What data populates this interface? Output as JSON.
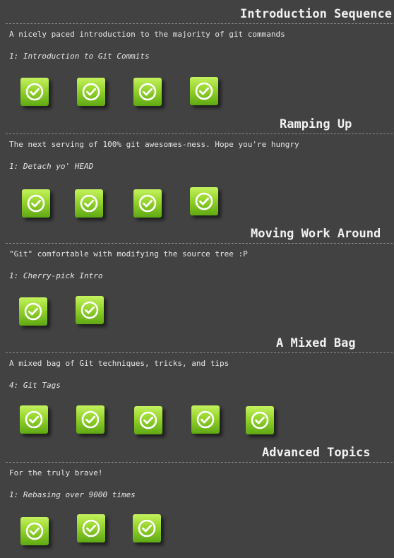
{
  "sections": [
    {
      "title": "Introduction Sequence",
      "description": "A nicely paced introduction to the majority of git commands",
      "current_level": "1: Introduction to Git Commits",
      "levels": [
        "completed",
        "completed",
        "completed",
        "completed"
      ]
    },
    {
      "title": "Ramping Up",
      "description": "The next serving of 100% git awesomes-ness. Hope you're hungry",
      "current_level": "1: Detach yo' HEAD",
      "levels": [
        "completed",
        "completed",
        "completed",
        "completed"
      ]
    },
    {
      "title": "Moving Work Around",
      "description": "\"Git\" comfortable with modifying the source tree :P",
      "current_level": "1: Cherry-pick Intro",
      "levels": [
        "completed",
        "completed"
      ]
    },
    {
      "title": "A Mixed Bag",
      "description": "A mixed bag of Git techniques, tricks, and tips",
      "current_level": "4: Git Tags",
      "levels": [
        "completed",
        "completed",
        "completed",
        "completed",
        "completed"
      ]
    },
    {
      "title": "Advanced Topics",
      "description": "For the truly brave!",
      "current_level": "1: Rebasing over 9000 times",
      "levels": [
        "completed",
        "completed",
        "completed"
      ]
    }
  ],
  "icons": {
    "level_status": "check-circle-icon"
  },
  "colors": {
    "background": "#424242",
    "button_top": "#c4f25e",
    "button_bottom": "#5fa814",
    "check": "#ffffff"
  }
}
